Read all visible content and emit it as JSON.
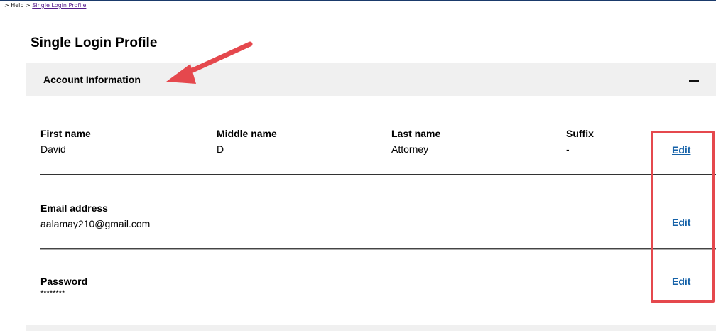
{
  "breadcrumb": {
    "prefix": "> Help > ",
    "current": "Single Login Profile"
  },
  "page": {
    "title": "Single Login Profile"
  },
  "section": {
    "title": "Account Information",
    "collapse_icon": "minus-icon"
  },
  "name_row": {
    "fields": [
      {
        "label": "First name",
        "value": "David"
      },
      {
        "label": "Middle name",
        "value": "D"
      },
      {
        "label": "Last name",
        "value": "Attorney"
      },
      {
        "label": "Suffix",
        "value": "-"
      }
    ],
    "edit_label": "Edit"
  },
  "email_row": {
    "label": "Email address",
    "value": "aalamay210@gmail.com",
    "edit_label": "Edit"
  },
  "password_row": {
    "label": "Password",
    "value": "********",
    "edit_label": "Edit"
  },
  "colors": {
    "link": "#1461a8",
    "annotation": "#e5484d",
    "section_bg": "#f0f0f0"
  }
}
